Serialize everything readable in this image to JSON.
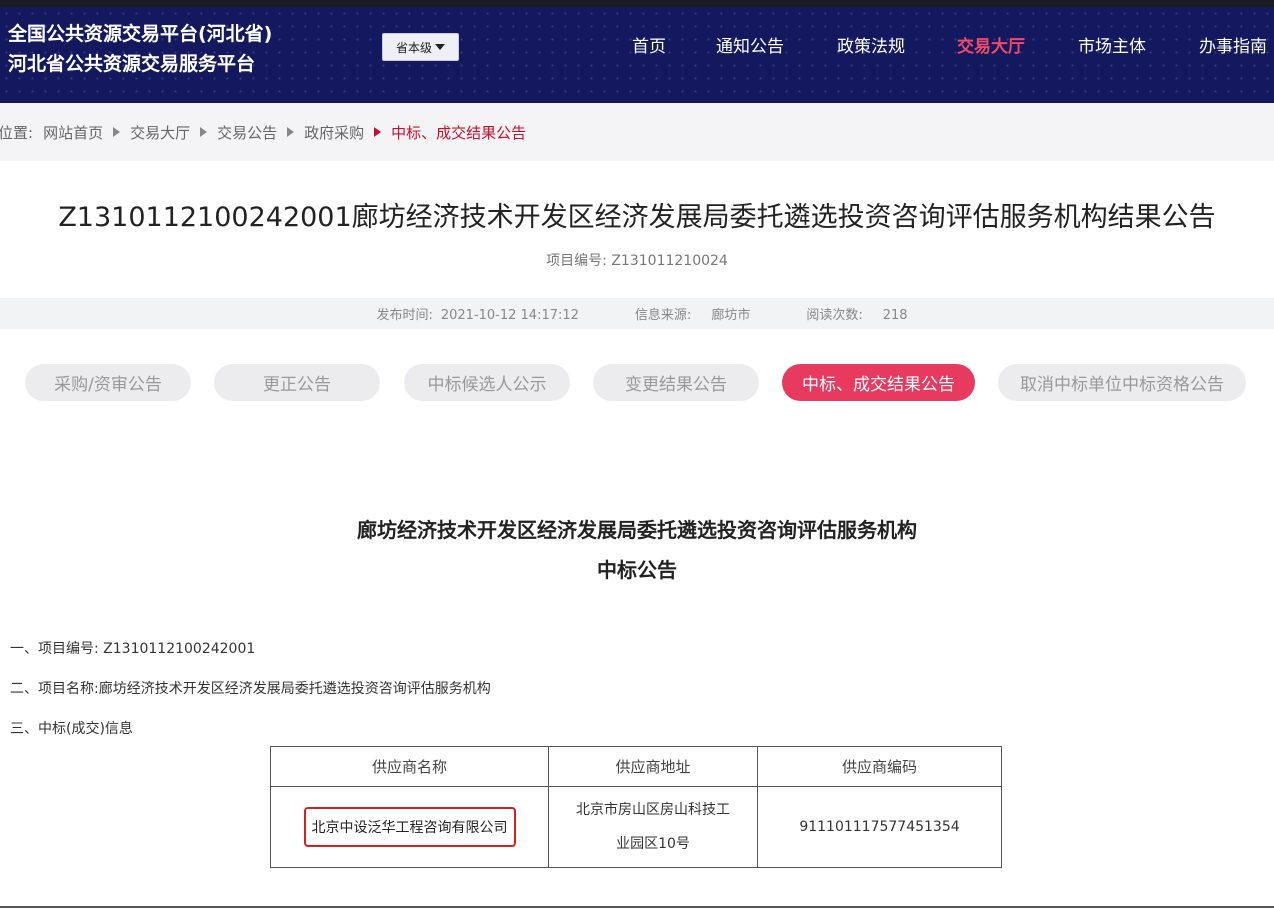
{
  "header": {
    "title_line1": "全国公共资源交易平台(河北省)",
    "title_line2": "河北省公共资源交易服务平台",
    "level_select": "省本级",
    "nav": [
      "首页",
      "通知公告",
      "政策法规",
      "交易大厅",
      "市场主体",
      "办事指南"
    ],
    "nav_active": "交易大厅",
    "accent_color": "#ef4a68",
    "background_color": "#14185e"
  },
  "breadcrumb": {
    "label": "位置:",
    "items": [
      "网站首页",
      "交易大厅",
      "交易公告",
      "政府采购"
    ],
    "current": "中标、成交结果公告"
  },
  "document": {
    "title": "Z1310112100242001廊坊经济技术开发区经济发展局委托遴选投资咨询评估服务机构结果公告",
    "project_no_label": "项目编号:",
    "project_no": "Z131011210024"
  },
  "meta": {
    "publish_label": "发布时间:",
    "publish_time": "2021-10-12 14:17:12",
    "source_label": "信息来源:",
    "source": "廊坊市",
    "views_label": "阅读次数:",
    "views": "218"
  },
  "tabs": [
    {
      "label": "采购/资审公告",
      "active": false
    },
    {
      "label": "更正公告",
      "active": false
    },
    {
      "label": "中标候选人公示",
      "active": false
    },
    {
      "label": "变更结果公告",
      "active": false
    },
    {
      "label": "中标、成交结果公告",
      "active": true
    },
    {
      "label": "取消中标单位中标资格公告",
      "active": false
    }
  ],
  "article": {
    "heading_line1": "廊坊经济技术开发区经济发展局委托遴选投资咨询评估服务机构",
    "heading_line2": "中标公告",
    "item1": "一、项目编号: Z1310112100242001",
    "item2": "二、项目名称:廊坊经济技术开发区经济发展局委托遴选投资咨询评估服务机构",
    "item3": "三、中标(成交)信息",
    "table": {
      "headers": [
        "供应商名称",
        "供应商地址",
        "供应商编码"
      ],
      "rows": [
        {
          "name": "北京中设泛华工程咨询有限公司",
          "address_line1": "北京市房山区房山科技工",
          "address_line2": "业园区10号",
          "code": "911101117577451354"
        }
      ]
    }
  }
}
